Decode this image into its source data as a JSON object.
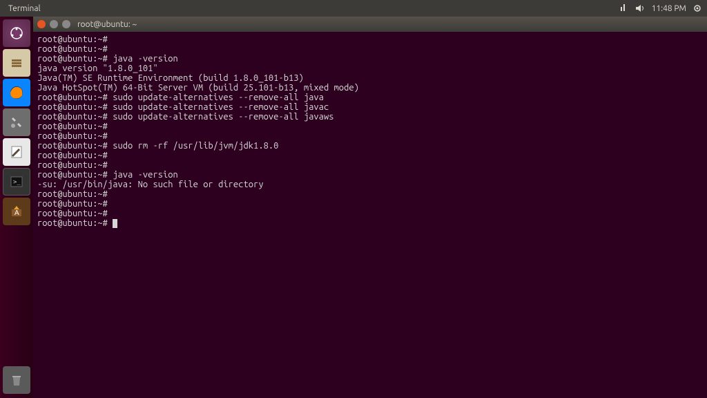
{
  "topbar": {
    "title": "Terminal",
    "time": "11:48 PM"
  },
  "window": {
    "title": "root@ubuntu: ~"
  },
  "prompt": "root@ubuntu:~#",
  "lines": [
    {
      "type": "prompt",
      "cmd": ""
    },
    {
      "type": "prompt",
      "cmd": ""
    },
    {
      "type": "prompt",
      "cmd": "java -version"
    },
    {
      "type": "output",
      "text": "java version \"1.8.0_101\""
    },
    {
      "type": "output",
      "text": "Java(TM) SE Runtime Environment (build 1.8.0_101-b13)"
    },
    {
      "type": "output",
      "text": "Java HotSpot(TM) 64-Bit Server VM (build 25.101-b13, mixed mode)"
    },
    {
      "type": "prompt",
      "cmd": "sudo update-alternatives --remove-all java"
    },
    {
      "type": "prompt",
      "cmd": "sudo update-alternatives --remove-all javac"
    },
    {
      "type": "prompt",
      "cmd": "sudo update-alternatives --remove-all javaws"
    },
    {
      "type": "prompt",
      "cmd": ""
    },
    {
      "type": "prompt",
      "cmd": ""
    },
    {
      "type": "prompt",
      "cmd": "sudo rm -rf /usr/lib/jvm/jdk1.8.0"
    },
    {
      "type": "prompt",
      "cmd": ""
    },
    {
      "type": "prompt",
      "cmd": ""
    },
    {
      "type": "prompt",
      "cmd": "java -version"
    },
    {
      "type": "output",
      "text": "-su: /usr/bin/java: No such file or directory"
    },
    {
      "type": "prompt",
      "cmd": ""
    },
    {
      "type": "prompt",
      "cmd": ""
    },
    {
      "type": "prompt",
      "cmd": ""
    },
    {
      "type": "prompt_cursor",
      "cmd": ""
    }
  ],
  "launcher": {
    "items": [
      "dash",
      "files",
      "firefox",
      "settings",
      "editor",
      "terminal",
      "updater"
    ]
  }
}
